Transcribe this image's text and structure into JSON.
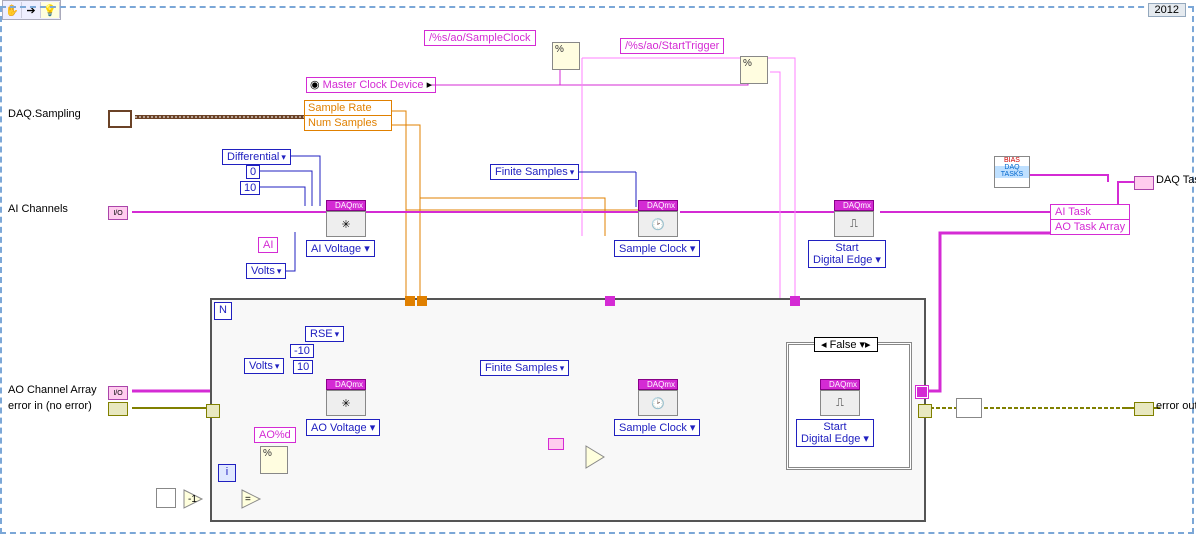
{
  "year_label": "2012",
  "terminals": {
    "daq_sampling": "DAQ.Sampling",
    "ai_channels": "AI Channels",
    "ao_channel_array": "AO Channel Array",
    "error_in": "error in (no error)",
    "error_out": "error out",
    "daq_tasks": "DAQ Tasks"
  },
  "unbundle": {
    "sample_rate": "Sample Rate",
    "num_samples": "Num Samples"
  },
  "strings": {
    "master_clock_device": "Master Clock Device",
    "sample_clock_fmt": "/%s/ao/SampleClock",
    "start_trigger_fmt": "/%s/ao/StartTrigger",
    "ai_str": "AI",
    "ao_fmt": "AO%d"
  },
  "ring": {
    "differential": "Differential",
    "rse": "RSE",
    "volts": "Volts",
    "finite_samples": "Finite Samples",
    "false_case": "False"
  },
  "const": {
    "zero": "0",
    "ten": "10",
    "neg_ten": "-10",
    "ten_b": "10"
  },
  "daqmx": {
    "hdr": "DAQmx",
    "ai_voltage": "AI Voltage",
    "ao_voltage": "AO Voltage",
    "sample_clock": "Sample Clock",
    "start_digital_edge_l1": "Start",
    "start_digital_edge_l2": "Digital Edge"
  },
  "bundle": {
    "ai_task": "AI Task",
    "ao_task_array": "AO Task Array"
  },
  "bias": {
    "l1": "BIAS",
    "l2": "DAQ",
    "l3": "TASKS"
  },
  "n_label": "N",
  "i_label": "i"
}
